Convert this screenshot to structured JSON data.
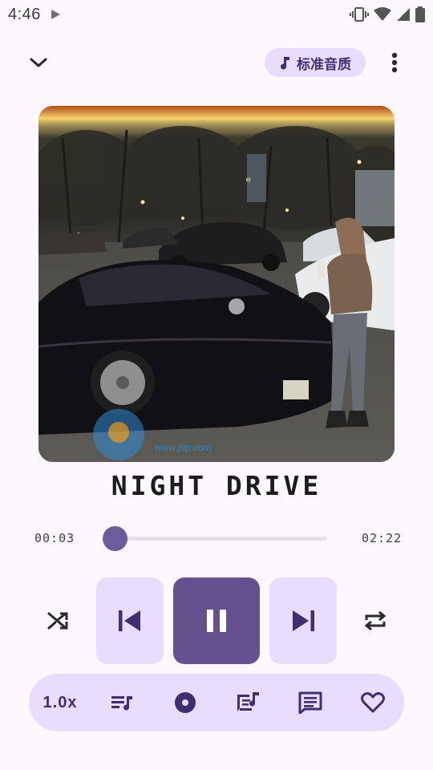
{
  "status_bar": {
    "time": "4:46",
    "icons": [
      "play-icon",
      "vibrate-icon",
      "wifi-icon",
      "signal-icon",
      "battery-icon"
    ]
  },
  "top_bar": {
    "collapse_icon": "chevron-down-icon",
    "quality_label": "标准音质",
    "quality_icon": "music-note-icon",
    "more_icon": "more-vert-icon"
  },
  "now_playing": {
    "title": "NIGHT DRIVE",
    "watermark": "www.j9p.com",
    "position": "00:03",
    "duration": "02:22",
    "progress": 0.021
  },
  "controls": {
    "shuffle_icon": "shuffle-icon",
    "prev_icon": "skip-previous-icon",
    "play_state_icon": "pause-icon",
    "next_icon": "skip-next-icon",
    "repeat_icon": "repeat-icon"
  },
  "bottom_bar": {
    "speed_label": "1.0x",
    "icons": [
      "queue-music-icon",
      "album-icon",
      "lyrics-icon",
      "comment-icon",
      "heart-icon"
    ]
  },
  "colors": {
    "background": "#fdf7fe",
    "accent": "#655090",
    "tonal": "#e8ddff",
    "thumb": "#6c5c9c"
  }
}
